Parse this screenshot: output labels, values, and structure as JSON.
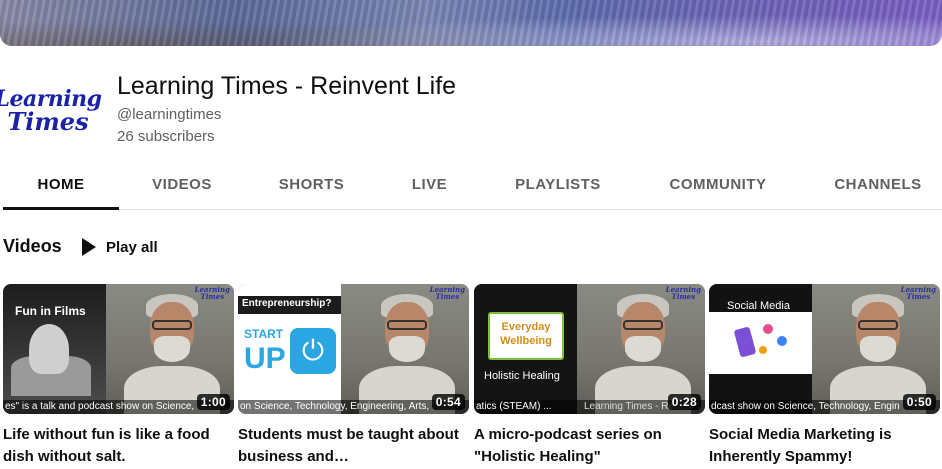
{
  "channel": {
    "avatar_line1": "Learning",
    "avatar_line2": "Times",
    "title": "Learning Times - Reinvent Life",
    "handle": "@learningtimes",
    "subscribers": "26 subscribers"
  },
  "tabs": [
    {
      "label": "HOME",
      "active": true
    },
    {
      "label": "VIDEOS",
      "active": false
    },
    {
      "label": "SHORTS",
      "active": false
    },
    {
      "label": "LIVE",
      "active": false
    },
    {
      "label": "PLAYLISTS",
      "active": false
    },
    {
      "label": "COMMUNITY",
      "active": false
    },
    {
      "label": "CHANNELS",
      "active": false
    }
  ],
  "section": {
    "title": "Videos",
    "play_all": "Play all"
  },
  "videos": [
    {
      "title": "Life without fun is like a food dish without salt.",
      "duration": "1:00",
      "overlay": "Fun in Films",
      "ticker": "es\" is a talk and podcast show on Science,"
    },
    {
      "title": "Students must be taught about business and…",
      "duration": "0:54",
      "overlay": "Entrepreneurship?",
      "overlay2": "START",
      "overlay3": "UP",
      "ticker": "on Science, Technology, Engineering, Arts,"
    },
    {
      "title": "A micro-podcast series on \"Holistic Healing\"",
      "duration": "0:28",
      "overlay": "Everyday Wellbeing",
      "overlay2": "Holistic Healing",
      "ticker": "atics (STEAM) ...",
      "ticker2": "Learning Times - Re"
    },
    {
      "title": "Social Media Marketing is Inherently Spammy!",
      "duration": "0:50",
      "overlay": "Social Media",
      "ticker": "dcast show on Science, Technology, Engin"
    }
  ],
  "thumb_logo": {
    "line1": "Learning",
    "line2": "Times"
  },
  "colors": {
    "text_primary": "#0f0f0f",
    "text_secondary": "#606060",
    "divider": "#e5e5e5",
    "logo_blue": "#1a22a8"
  }
}
